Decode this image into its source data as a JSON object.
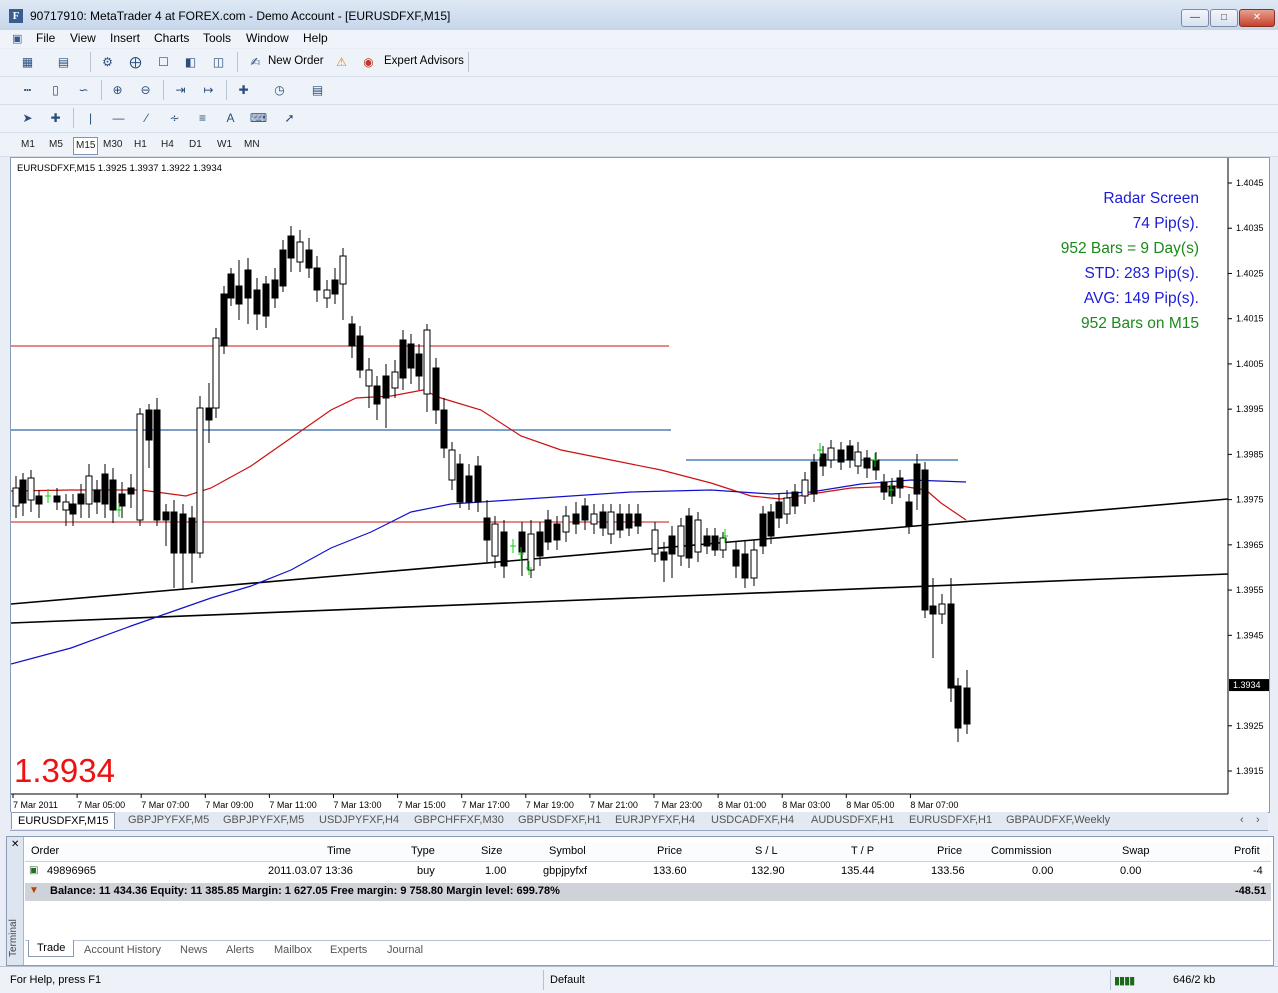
{
  "window": {
    "title": "90717910: MetaTrader 4 at FOREX.com - Demo Account - [EURUSDFXF,M15]",
    "app_icon": "F"
  },
  "menu": [
    "File",
    "View",
    "Insert",
    "Charts",
    "Tools",
    "Window",
    "Help"
  ],
  "toolbar": {
    "new_order_label": "New Order",
    "expert_advisors_label": "Expert Advisors"
  },
  "timeframes": [
    "M1",
    "M5",
    "M15",
    "M30",
    "H1",
    "H4",
    "D1",
    "W1",
    "MN"
  ],
  "active_timeframe": "M15",
  "chart": {
    "ohlc_header": "EURUSDFXF,M15  1.3925 1.3937 1.3922 1.3934",
    "big_price": "1.3934",
    "current_price_tag": "1.3934",
    "radar": [
      {
        "text": "Radar Screen",
        "color": "#1c1cd8"
      },
      {
        "text": "74 Pip(s).",
        "color": "#1c1cd8"
      },
      {
        "text": "952 Bars = 9 Day(s)",
        "color": "#1a8a1a"
      },
      {
        "text": "STD: 283 Pip(s).",
        "color": "#1c1cd8"
      },
      {
        "text": "AVG: 149 Pip(s).",
        "color": "#1c1cd8"
      },
      {
        "text": "952 Bars on M15",
        "color": "#1a8a1a"
      }
    ],
    "price_axis": [
      "1.4045",
      "1.4035",
      "1.4025",
      "1.4015",
      "1.4005",
      "1.3995",
      "1.3985",
      "1.3975",
      "1.3965",
      "1.3955",
      "1.3945",
      "1.3925",
      "1.3915"
    ],
    "time_axis": [
      "7 Mar 2011",
      "7 Mar 05:00",
      "7 Mar 07:00",
      "7 Mar 09:00",
      "7 Mar 11:00",
      "7 Mar 13:00",
      "7 Mar 15:00",
      "7 Mar 17:00",
      "7 Mar 19:00",
      "7 Mar 21:00",
      "7 Mar 23:00",
      "8 Mar 01:00",
      "8 Mar 03:00",
      "8 Mar 05:00",
      "8 Mar 07:00"
    ],
    "colors": {
      "candle_up": "#ffffff",
      "candle_down": "#000000",
      "ma_fast": "#cc1111",
      "ma_slow": "#1111cc",
      "hline_red": "#cc1111",
      "hline_blue": "#2a66aa",
      "tick_green": "#11cc11"
    }
  },
  "chart_data": {
    "type": "candlestick",
    "symbol": "EURUSDFXF",
    "timeframe": "M15",
    "ylim": [
      1.391,
      1.405
    ],
    "closes_approx": [
      1.3976,
      1.3975,
      1.3974,
      1.3972,
      1.397,
      1.3974,
      1.398,
      1.396,
      1.399,
      1.401,
      1.402,
      1.4022,
      1.4018,
      1.4025,
      1.403,
      1.4032,
      1.4028,
      1.402,
      1.401,
      1.3998,
      1.3995,
      1.4002,
      1.3998,
      1.399,
      1.398,
      1.397,
      1.3965,
      1.3962,
      1.396,
      1.3965,
      1.3968,
      1.3972,
      1.397,
      1.3968,
      1.397,
      1.3966,
      1.3962,
      1.396,
      1.3962,
      1.3966,
      1.397,
      1.3965,
      1.3962,
      1.396,
      1.3972,
      1.3978,
      1.3985,
      1.3984,
      1.3982,
      1.3975,
      1.397,
      1.3982,
      1.395,
      1.394,
      1.3935,
      1.3925,
      1.3934
    ]
  },
  "chart_tabs": [
    "EURUSDFXF,M15",
    "GBPJPYFXF,M5",
    "GBPJPYFXF,M5",
    "USDJPYFXF,H4",
    "GBPCHFFXF,M30",
    "GBPUSDFXF,H1",
    "EURJPYFXF,H4",
    "USDCADFXF,H4",
    "AUDUSDFXF,H1",
    "EURUSDFXF,H1",
    "GBPAUDFXF,Weekly"
  ],
  "terminal": {
    "side_label": "Terminal",
    "columns": [
      "Order",
      "Time",
      "Type",
      "Size",
      "Symbol",
      "Price",
      "S / L",
      "T / P",
      "Price",
      "Commission",
      "Swap",
      "Profit"
    ],
    "order": {
      "order": "49896965",
      "time": "2011.03.07 13:36",
      "type": "buy",
      "size": "1.00",
      "symbol": "gbpjpyfxf",
      "price": "133.60",
      "sl": "132.90",
      "tp": "135.44",
      "cur_price": "133.56",
      "commission": "0.00",
      "swap": "0.00",
      "profit": "-4"
    },
    "balance_line": "Balance: 11 434.36  Equity: 11 385.85  Margin: 1 627.05  Free margin: 9 758.80  Margin level: 699.78%",
    "balance_profit": "-48.51",
    "tabs": [
      "Trade",
      "Account History",
      "News",
      "Alerts",
      "Mailbox",
      "Experts",
      "Journal"
    ]
  },
  "status": {
    "help": "For Help, press F1",
    "profile": "Default",
    "traffic": "646/2 kb"
  }
}
